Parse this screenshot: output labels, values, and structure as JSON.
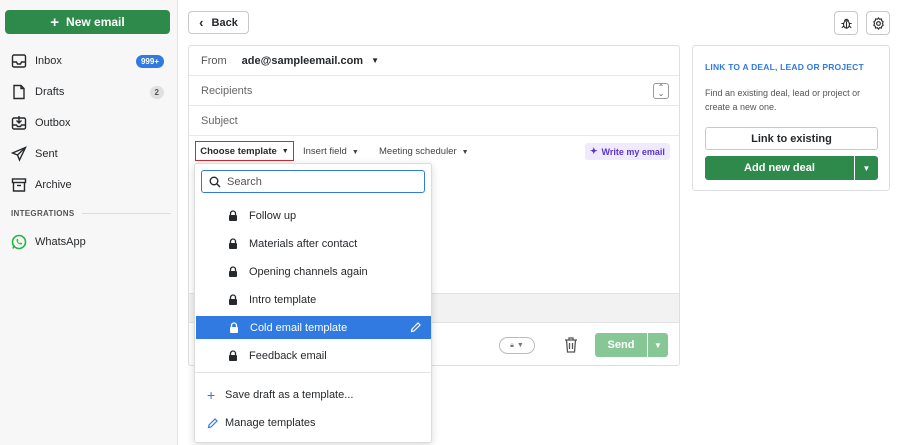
{
  "sidebar": {
    "new_email_label": "New email",
    "items": [
      {
        "label": "Inbox",
        "badge": "999+"
      },
      {
        "label": "Drafts",
        "badge": "2"
      },
      {
        "label": "Outbox"
      },
      {
        "label": "Sent"
      },
      {
        "label": "Archive"
      }
    ],
    "section_label": "INTEGRATIONS",
    "integrations": [
      {
        "label": "WhatsApp"
      }
    ]
  },
  "topbar": {
    "back_label": "Back"
  },
  "composer": {
    "from_label": "From",
    "from_value": "ade@sampleemail.com",
    "recipients_placeholder": "Recipients",
    "subject_placeholder": "Subject",
    "toolbar": {
      "choose_template": "Choose template",
      "insert_field": "Insert field",
      "meeting_scheduler": "Meeting scheduler",
      "write_my_email": "Write my email"
    },
    "send_label": "Send"
  },
  "template_menu": {
    "search_placeholder": "Search",
    "templates": [
      {
        "label": "Follow up"
      },
      {
        "label": "Materials after contact"
      },
      {
        "label": "Opening channels again"
      },
      {
        "label": "Intro template"
      },
      {
        "label": "Cold email template",
        "selected": true
      },
      {
        "label": "Feedback email"
      }
    ],
    "actions": {
      "save_draft": "Save draft as a template...",
      "manage": "Manage templates"
    }
  },
  "deal_panel": {
    "title": "LINK TO A DEAL, LEAD OR PROJECT",
    "description": "Find an existing deal, lead or project or create a new one.",
    "link_existing": "Link to existing",
    "add_new_deal": "Add new deal"
  },
  "colors": {
    "primary_green": "#2d8a4a",
    "accent_blue": "#317ae2",
    "send_disabled": "#87c796",
    "ai_purple": "#5c36c9",
    "highlight_red": "#d9262b"
  }
}
